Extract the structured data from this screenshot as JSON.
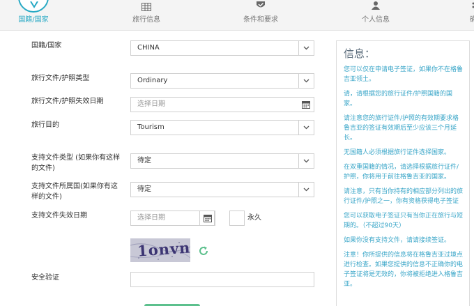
{
  "steps": [
    {
      "label": "国籍/国家",
      "icon": "location-pin-icon"
    },
    {
      "label": "旅行信息",
      "icon": "calendar-grid-icon"
    },
    {
      "label": "条件和要求",
      "icon": "shield-check-icon"
    },
    {
      "label": "个人信息",
      "icon": "user-icon"
    },
    {
      "label": "确",
      "icon": "overflow-icon"
    }
  ],
  "form": {
    "nationality": {
      "label": "国籍/国家",
      "value": "CHINA"
    },
    "doc_type": {
      "label": "旅行文件/护照类型",
      "value": "Ordinary"
    },
    "doc_expiry": {
      "label": "旅行文件/护照失效日期",
      "placeholder": "选择日期"
    },
    "purpose": {
      "label": "旅行目的",
      "value": "Tourism"
    },
    "support_type": {
      "label_l1": "支持文件类型 (如果你有这样",
      "label_l2": "的文件)",
      "value": "待定"
    },
    "support_country": {
      "label_l1": "支持文件所属国(如果你有这",
      "label_l2": "样的文件)",
      "value": "待定"
    },
    "support_expiry": {
      "label": "支持文件失效日期",
      "placeholder": "选择日期",
      "permanent_label": "永久"
    },
    "captcha": {
      "text": "1onvn"
    },
    "security": {
      "label": "安全验证",
      "value": ""
    }
  },
  "info": {
    "title": "信息：",
    "paragraphs": [
      "您可以仅在申请电子签证，如果你不在格鲁吉亚领土。",
      "请，请根据您的旅行证件/护照国籍的国家。",
      "请注意您的旅行证件/护照的有效期要求格鲁吉亚的签证有效期后至少应该三个月延长。",
      "无国籍人必须根据旅行证件选择国家。",
      "在双重国籍的情况，请选择根据旅行证件/护照，你将用于前往格鲁吉亚的国家。",
      "请注意，只有当你持有的相应部分列出的旅行证件/护照之一，你有资格获得电子签证",
      "您可以获取电子签证只有当你正在旅行与短期的。（不超过90天）",
      "如果你没有支持文件，请请接续签证。",
      "注意！你所提供的信息将在格鲁吉亚过境点进行检查。如果您提供的信息不正确你的电子签证将是无效的，你将被拒绝进入格鲁吉亚。"
    ]
  },
  "colors": {
    "accent": "#27a9c4",
    "info_text": "#3aa6c8",
    "button_green": "#5cc08d"
  }
}
